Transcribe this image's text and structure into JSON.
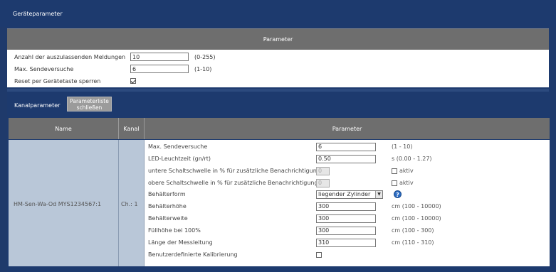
{
  "header": {
    "title": "Geräteparameter"
  },
  "device_section": {
    "heading": "Parameter",
    "rows": [
      {
        "label": "Anzahl der auszulassenden Meldungen",
        "value": "10",
        "range": "(0-255)"
      },
      {
        "label": "Max. Sendeversuche",
        "value": "6",
        "range": "(1-10)"
      },
      {
        "label": "Reset per Gerätetaste sperren",
        "checked": true
      }
    ]
  },
  "channel_bar": {
    "label": "Kanalparameter",
    "close_button": "Parameterliste schließen"
  },
  "channel_table": {
    "headers": {
      "name": "Name",
      "kanal": "Kanal",
      "parameter": "Parameter"
    },
    "device_name": "HM-Sen-Wa-Od MYS1234567:1",
    "channel": "Ch.: 1",
    "params": {
      "max_send": {
        "label": "Max. Sendeversuche",
        "value": "6",
        "range": "(1 - 10)"
      },
      "led": {
        "label": "LED-Leuchtzeit (gn/rt)",
        "value": "0.50",
        "range": "s (0.00 - 1.27)"
      },
      "lower_threshold": {
        "label": "untere Schaltschwelle in % für zusätzliche Benachrichtigung",
        "value": "0",
        "check_label": "aktiv",
        "checked": false
      },
      "upper_threshold": {
        "label": "obere Schaltschwelle in % für zusätzliche Benachrichtigung",
        "value": "0",
        "check_label": "aktiv",
        "checked": false
      },
      "shape": {
        "label": "Behälterform",
        "selected": "liegender Zylinder"
      },
      "height": {
        "label": "Behälterhöhe",
        "value": "300",
        "range": "cm (100 - 10000)"
      },
      "width": {
        "label": "Behälterweite",
        "value": "300",
        "range": "cm (100 - 10000)"
      },
      "fill": {
        "label": "Füllhöhe bei 100%",
        "value": "300",
        "range": "cm (100 - 300)"
      },
      "line": {
        "label": "Länge der Messleitung",
        "value": "310",
        "range": "cm (110 - 310)"
      },
      "calib": {
        "label": "Benutzerdefinierte Kalibrierung",
        "checked": false
      }
    }
  },
  "icons": {
    "help": "help-icon",
    "dropdown": "chevron-down-icon",
    "checkbox": "checkbox"
  },
  "colors": {
    "navy": "#1d3a6e",
    "grey_header": "#6e6e6e",
    "name_column": "#b9c7d8",
    "help_blue": "#2b6cc4"
  }
}
